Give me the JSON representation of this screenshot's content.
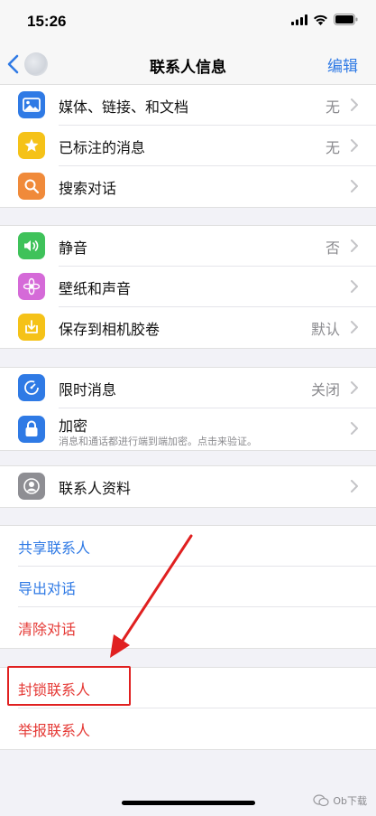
{
  "status_bar": {
    "time": "15:26"
  },
  "nav": {
    "title": "联系人信息",
    "edit_label": "编辑"
  },
  "group1": [
    {
      "label": "媒体、链接、和文档",
      "value": "无",
      "icon": "photo-icon",
      "color": "#2f7ae5"
    },
    {
      "label": "已标注的消息",
      "value": "无",
      "icon": "star-icon",
      "color": "#f5c218"
    },
    {
      "label": "搜索对话",
      "value": "",
      "icon": "search-icon",
      "color": "#f08a3a"
    }
  ],
  "group2": [
    {
      "label": "静音",
      "value": "否",
      "icon": "speaker-icon",
      "color": "#3fc25a"
    },
    {
      "label": "壁纸和声音",
      "value": "",
      "icon": "flower-icon",
      "color": "#d56ad8"
    },
    {
      "label": "保存到相机胶卷",
      "value": "默认",
      "icon": "download-icon",
      "color": "#f5c218"
    }
  ],
  "group3": [
    {
      "label": "限时消息",
      "value": "关闭",
      "icon": "timer-icon",
      "color": "#2f7ae5"
    },
    {
      "label": "加密",
      "sublabel": "消息和通话都进行端到端加密。点击来验证。",
      "value": "",
      "icon": "lock-icon",
      "color": "#2f7ae5"
    }
  ],
  "group4": [
    {
      "label": "联系人资料",
      "value": "",
      "icon": "contact-icon",
      "color": "#8e8e93"
    }
  ],
  "group5": [
    {
      "label": "共享联系人"
    },
    {
      "label": "导出对话"
    },
    {
      "label": "清除对话"
    }
  ],
  "group6": [
    {
      "label": "封锁联系人"
    },
    {
      "label": "举报联系人"
    }
  ],
  "watermark": "Ob下载"
}
